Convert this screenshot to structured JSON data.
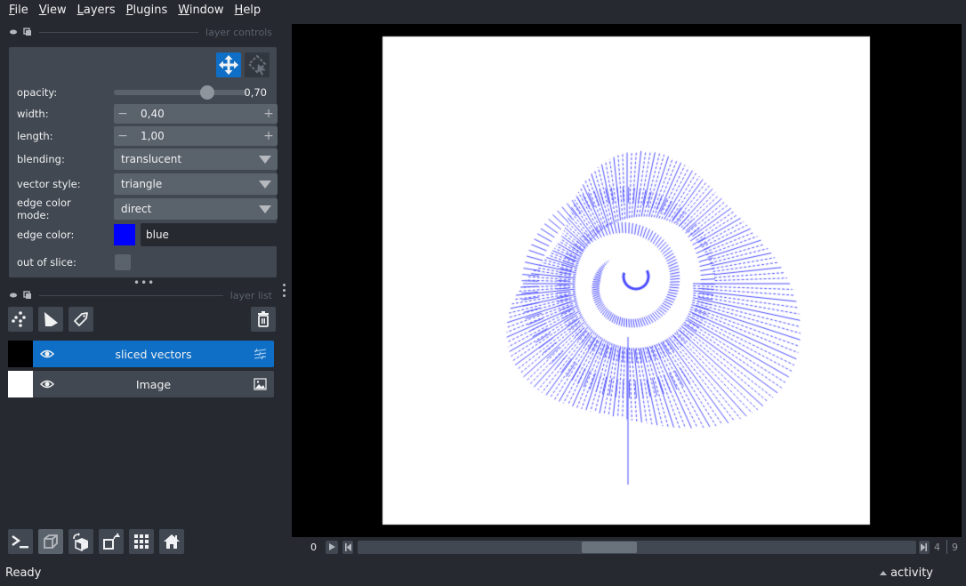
{
  "menu": [
    {
      "label": "File",
      "mnemonic": "F",
      "rest": "ile"
    },
    {
      "label": "View",
      "mnemonic": "V",
      "rest": "iew"
    },
    {
      "label": "Layers",
      "mnemonic": "L",
      "rest": "ayers"
    },
    {
      "label": "Plugins",
      "mnemonic": "P",
      "rest": "lugins"
    },
    {
      "label": "Window",
      "mnemonic": "W",
      "rest": "indow"
    },
    {
      "label": "Help",
      "mnemonic": "H",
      "rest": "elp"
    }
  ],
  "layer_controls": {
    "title": "layer controls",
    "modes": [
      {
        "name": "pan-zoom",
        "icon": "move-arrows-icon",
        "active": true
      },
      {
        "name": "select",
        "icon": "select-cursor-icon",
        "active": false
      }
    ],
    "opacity": {
      "label": "opacity:",
      "value": 0.7,
      "display": "0,70"
    },
    "width": {
      "label": "width:",
      "display": "0,40",
      "minus": "−",
      "plus": "+"
    },
    "length": {
      "label": "length:",
      "display": "1,00",
      "minus": "−",
      "plus": "+"
    },
    "blending": {
      "label": "blending:",
      "value": "translucent"
    },
    "vector_style": {
      "label": "vector style:",
      "value": "triangle"
    },
    "edge_color_mode": {
      "label": "edge color mode:",
      "value": "direct"
    },
    "edge_color": {
      "label": "edge color:",
      "value": "blue",
      "hex": "#0000ff"
    },
    "out_of_slice": {
      "label": "out of slice:",
      "checked": false
    }
  },
  "layer_list": {
    "title": "layer list",
    "tools": [
      "new-points-layer",
      "new-shapes-layer",
      "new-labels-layer"
    ],
    "delete": "delete-layer",
    "layers": [
      {
        "name": "sliced vectors",
        "type": "vectors",
        "visible": true,
        "selected": true,
        "thumb": "#000000"
      },
      {
        "name": "Image",
        "type": "image",
        "visible": true,
        "selected": false,
        "thumb": "#ffffff"
      }
    ]
  },
  "viewer_buttons": [
    "console",
    "toggle-ndisplay",
    "roll-dimensions",
    "transpose-dimensions",
    "grid-mode",
    "reset-view"
  ],
  "dims": {
    "current_frame": "0",
    "current_step": "4",
    "max_step": "9",
    "slider_fraction": 0.42
  },
  "status": {
    "text": "Ready",
    "activity": "activity"
  },
  "colors": {
    "accent": "#0f6fc6",
    "background": "#262930",
    "panel": "#414851",
    "control": "#5a626c",
    "vector": "#4a4cff"
  }
}
